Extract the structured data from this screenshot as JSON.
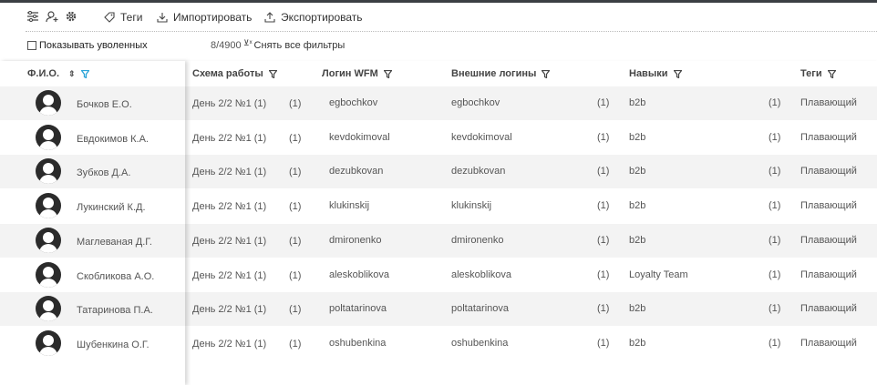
{
  "toolbar": {
    "tags_label": "Теги",
    "import_label": "Импортировать",
    "export_label": "Экспортировать"
  },
  "filters": {
    "show_fired_label": "Показывать уволенных",
    "show_fired_checked": false,
    "count_text": "8/4900",
    "clear_label": "Снять все фильтры"
  },
  "columns": {
    "name": "Ф.И.О.",
    "schedule": "Схема работы",
    "wfm_login": "Логин WFM",
    "ext_logins": "Внешние логины",
    "skills": "Навыки",
    "tags": "Теги"
  },
  "colors": {
    "accent": "#2aa4d8",
    "alt_row": "#f3f3f3"
  },
  "rows": [
    {
      "name": "Бочков Е.О.",
      "schedule": "День 2/2 №1 (1)",
      "schedule_count": "(1)",
      "login": "egbochkov",
      "ext_login": "egbochkov",
      "ext_count": "(1)",
      "skill": "b2b",
      "skill_count": "(1)",
      "tag": "Плавающий"
    },
    {
      "name": "Евдокимов К.А.",
      "schedule": "День 2/2 №1 (1)",
      "schedule_count": "(1)",
      "login": "kevdokimoval",
      "ext_login": "kevdokimoval",
      "ext_count": "(1)",
      "skill": "b2b",
      "skill_count": "(1)",
      "tag": "Плавающий"
    },
    {
      "name": "Зубков Д.А.",
      "schedule": "День 2/2 №1 (1)",
      "schedule_count": "(1)",
      "login": "dezubkovan",
      "ext_login": "dezubkovan",
      "ext_count": "(1)",
      "skill": "b2b",
      "skill_count": "(1)",
      "tag": "Плавающий"
    },
    {
      "name": "Лукинский К.Д.",
      "schedule": "День 2/2 №1 (1)",
      "schedule_count": "(1)",
      "login": "klukinskij",
      "ext_login": "klukinskij",
      "ext_count": "(1)",
      "skill": "b2b",
      "skill_count": "(1)",
      "tag": "Плавающий"
    },
    {
      "name": "Маглеваная Д.Г.",
      "schedule": "День 2/2 №1 (1)",
      "schedule_count": "(1)",
      "login": "dmironenko",
      "ext_login": "dmironenko",
      "ext_count": "(1)",
      "skill": "b2b",
      "skill_count": "(1)",
      "tag": "Плавающий"
    },
    {
      "name": "Скобликова А.О.",
      "schedule": "День 2/2 №1 (1)",
      "schedule_count": "(1)",
      "login": "aleskoblikova",
      "ext_login": "aleskoblikova",
      "ext_count": "(1)",
      "skill": "Loyalty Team",
      "skill_count": "(1)",
      "tag": "Плавающий"
    },
    {
      "name": "Татаринова П.А.",
      "schedule": "День 2/2 №1 (1)",
      "schedule_count": "(1)",
      "login": "poltatarinova",
      "ext_login": "poltatarinova",
      "ext_count": "(1)",
      "skill": "b2b",
      "skill_count": "(1)",
      "tag": "Плавающий"
    },
    {
      "name": "Шубенкина О.Г.",
      "schedule": "День 2/2 №1 (1)",
      "schedule_count": "(1)",
      "login": "oshubenkina",
      "ext_login": "oshubenkina",
      "ext_count": "(1)",
      "skill": "b2b",
      "skill_count": "(1)",
      "tag": "Плавающий"
    }
  ]
}
